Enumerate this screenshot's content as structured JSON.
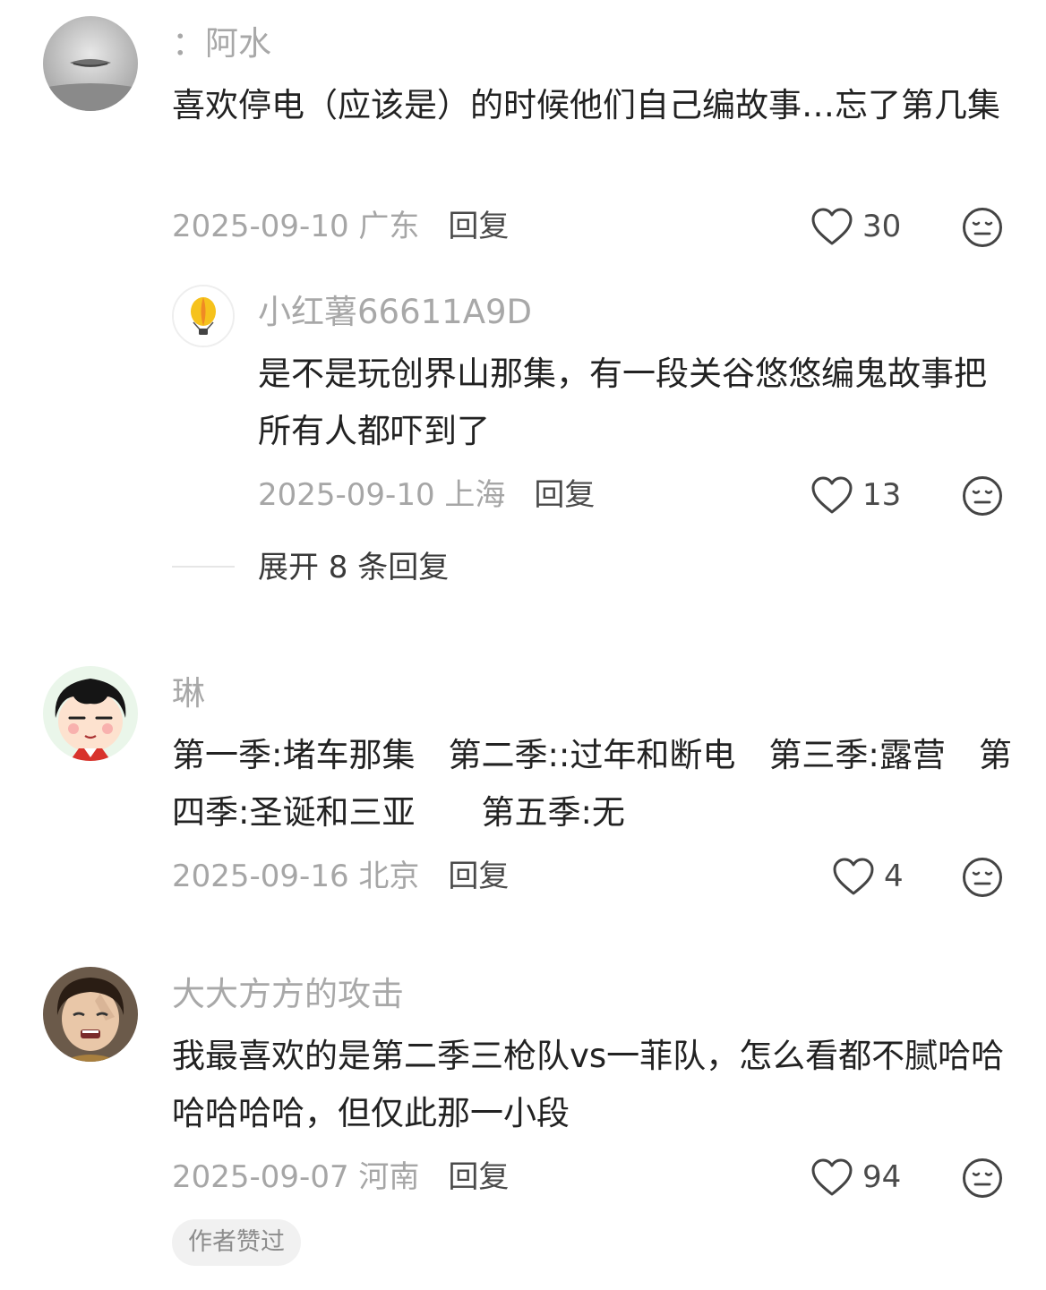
{
  "comments": [
    {
      "user": "：阿水",
      "content": "喜欢停电（应该是）的时候他们自己编故事…忘了第几集",
      "date": "2025-09-10",
      "location": "广东",
      "reply_label": "回复",
      "likes": "30",
      "reply": {
        "user": "小红薯66611A9D",
        "content": "是不是玩创界山那集，有一段关谷悠悠编鬼故事把所有人都吓到了",
        "date": "2025-09-10",
        "location": "上海",
        "reply_label": "回复",
        "likes": "13"
      },
      "expand_label": "展开 8 条回复"
    },
    {
      "user": "琳",
      "content": "第一季:堵车那集　第二季::过年和断电　第三季:露营　第四季:圣诞和三亚　　第五季:无",
      "date": "2025-09-16",
      "location": "北京",
      "reply_label": "回复",
      "likes": "4"
    },
    {
      "user": "大大方方的攻击",
      "content": "我最喜欢的是第二季三枪队vs一菲队，怎么看都不腻哈哈哈哈哈哈，但仅此那一小段",
      "date": "2025-09-07",
      "location": "河南",
      "reply_label": "回复",
      "likes": "94",
      "badge": "作者赞过"
    }
  ],
  "icons": {
    "like": "heart-outline-icon",
    "react": "neutral-face-icon"
  },
  "colors": {
    "text": "#222222",
    "muted": "#a6a6a6",
    "icon": "#444444"
  }
}
